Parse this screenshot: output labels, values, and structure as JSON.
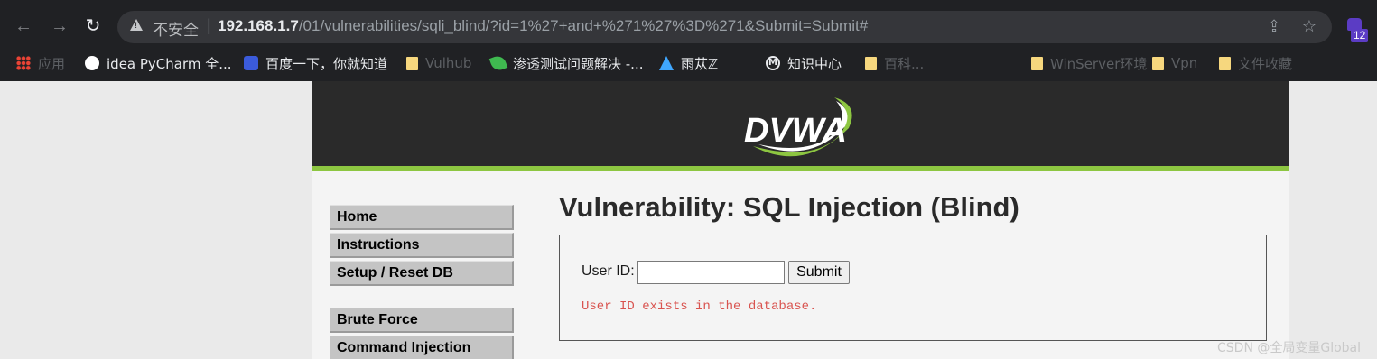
{
  "browser": {
    "not_secure_label": "不安全",
    "url_host": "192.168.1.7",
    "url_path": "/01/vulnerabilities/sqli_blind/?id=1%27+and+%271%27%3D%271&Submit=Submit#",
    "extension_badge": "12"
  },
  "bookmarks": [
    {
      "label": "应用",
      "icon": "apps-icon"
    },
    {
      "label": "idea PyCharm 全...",
      "icon": "globe-icon"
    },
    {
      "label": "百度一下，你就知道",
      "icon": "baidu-icon"
    },
    {
      "label": "Vulhub",
      "icon": "folder-icon"
    },
    {
      "label": "渗透测试问题解决 -...",
      "icon": "leaf-icon"
    },
    {
      "label": "雨苁ℤ",
      "icon": "triangle-icon"
    },
    {
      "label": "知识中心",
      "icon": "m-icon"
    },
    {
      "label": "百科...",
      "icon": "folder-icon"
    },
    {
      "label": "WinServer环境",
      "icon": "folder-icon"
    },
    {
      "label": "Vpn",
      "icon": "folder-icon"
    },
    {
      "label": "文件收藏",
      "icon": "folder-icon"
    }
  ],
  "dvwa": {
    "logo_text": "DVWA",
    "menu": [
      "Home",
      "Instructions",
      "Setup / Reset DB",
      "Brute Force",
      "Command Injection"
    ],
    "title": "Vulnerability: SQL Injection (Blind)",
    "user_id_label": "User ID:",
    "user_id_value": "",
    "submit_label": "Submit",
    "result_message": "User ID exists in the database."
  },
  "watermark": "CSDN @全局变量Global",
  "colors": {
    "accent_green": "#8dc641",
    "header_bg": "#2a2a2a",
    "result_red": "#d9534f"
  }
}
